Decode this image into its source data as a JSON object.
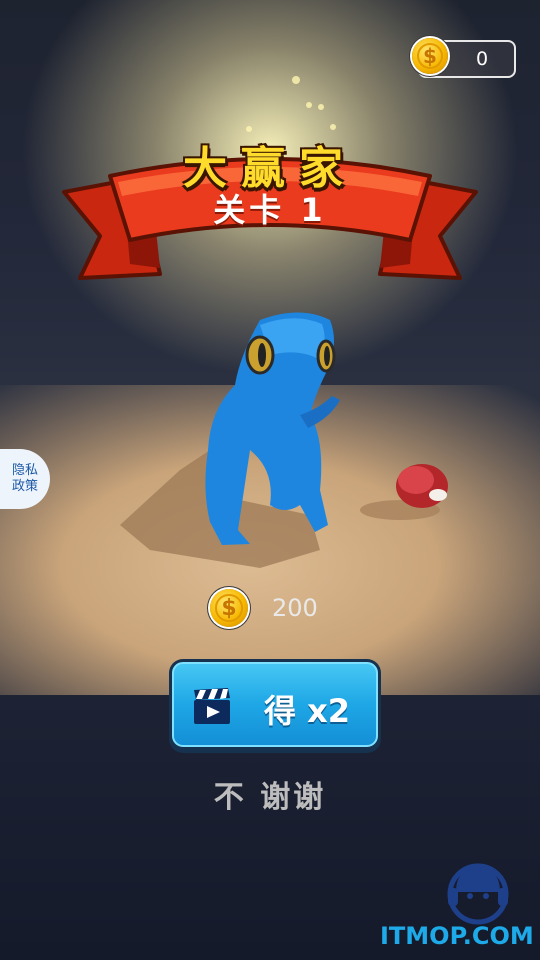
{
  "hud": {
    "coin_balance": "0"
  },
  "banner": {
    "title": "大赢家",
    "level": "关卡 1"
  },
  "privacy": {
    "label": "隐私\n政策"
  },
  "reward": {
    "amount": "200"
  },
  "double_button": {
    "label": "得 x2",
    "icon": "video-clapper-icon"
  },
  "skip": {
    "label": "不 谢谢"
  },
  "watermark": {
    "text": "ITMOP.COM",
    "icon": "support-headset-icon"
  },
  "colors": {
    "gold": "#ffdc2c",
    "button_blue": "#1ea7e6",
    "banner_red": "#e8331a",
    "dino_blue": "#1f86e0"
  }
}
